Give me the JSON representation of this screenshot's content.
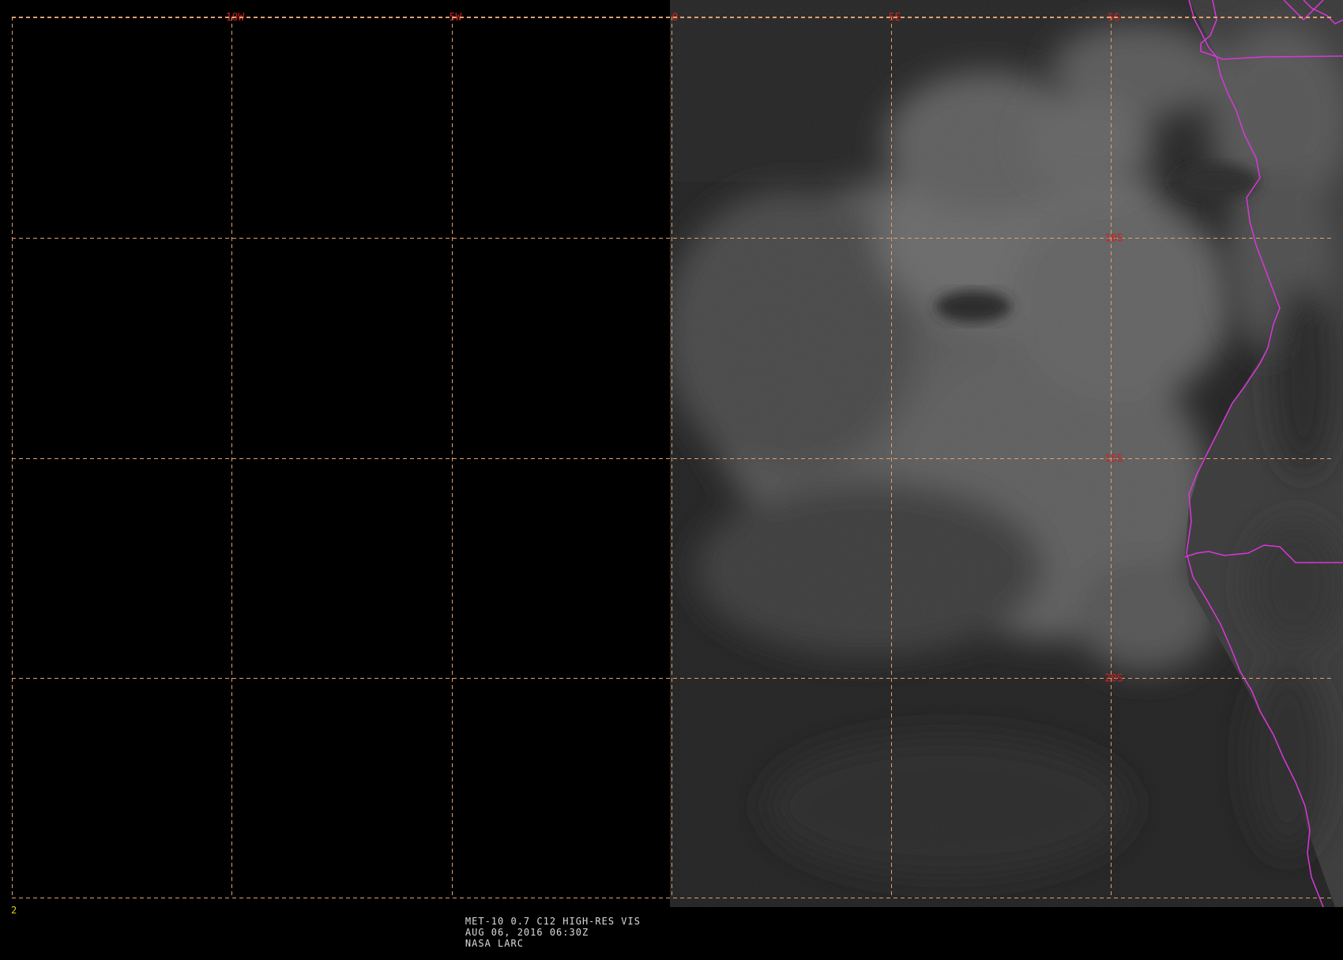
{
  "viewer": {
    "frame_number": "2",
    "caption": {
      "product": "MET-10 0.7 C12 HIGH-RES VIS",
      "datetime": "AUG 06, 2016 06:30Z",
      "source": "NASA LARC"
    }
  },
  "map": {
    "projection": "lat-lon",
    "longitude_range": [
      -15,
      15
    ],
    "latitude_range": [
      -25.5,
      0
    ],
    "graticule": {
      "longitudes": [
        {
          "value": -15,
          "label": ""
        },
        {
          "value": -10,
          "label": "10W"
        },
        {
          "value": -5,
          "label": "5W"
        },
        {
          "value": 0,
          "label": "0"
        },
        {
          "value": 5,
          "label": "5E"
        },
        {
          "value": 10,
          "label": ""
        }
      ],
      "latitudes": [
        {
          "value": -5,
          "label": "5S"
        },
        {
          "value": -10,
          "label": "10S"
        },
        {
          "value": -15,
          "label": "15S"
        },
        {
          "value": -20,
          "label": "20S"
        },
        {
          "value": -25,
          "label": ""
        }
      ]
    },
    "colors": {
      "background": "#000000",
      "gridline": "#e0a070",
      "grid_label": "#d02020",
      "border": "#d838d8",
      "ocean": "#232323",
      "cloud": "#6e6e6e",
      "land": "#353535",
      "frame_number": "#e0d000",
      "caption_text": "#dcdcdc"
    }
  }
}
